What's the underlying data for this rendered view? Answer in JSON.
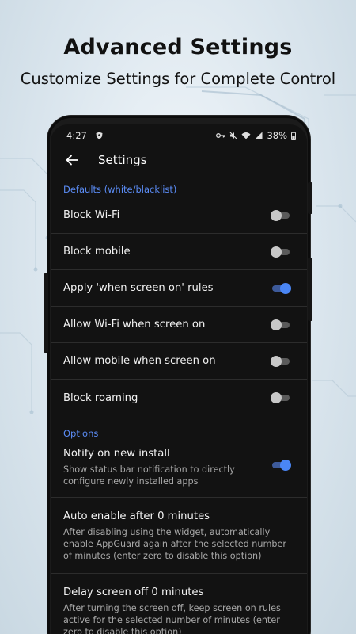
{
  "promo": {
    "title": "Advanced Settings",
    "subtitle": "Customize Settings for Complete Control"
  },
  "status_bar": {
    "time": "4:27",
    "battery": "38%",
    "icons": [
      "shield-icon",
      "key-icon",
      "mute-icon",
      "wifi-icon",
      "signal-icon",
      "battery-icon"
    ]
  },
  "toolbar": {
    "back_icon": "arrow-back-icon",
    "title": "Settings"
  },
  "defaults": {
    "header": "Defaults (white/blacklist)",
    "items": [
      {
        "label": "Block Wi-Fi",
        "on": false
      },
      {
        "label": "Block mobile",
        "on": false
      },
      {
        "label": "Apply 'when screen on' rules",
        "on": true
      },
      {
        "label": "Allow Wi-Fi when screen on",
        "on": false
      },
      {
        "label": "Allow mobile when screen on",
        "on": false
      },
      {
        "label": "Block roaming",
        "on": false
      }
    ]
  },
  "options": {
    "header": "Options",
    "items": [
      {
        "title": "Notify on new install",
        "description": "Show status bar notification to directly configure newly installed apps",
        "on": true
      },
      {
        "title": "Auto enable after 0 minutes",
        "description": "After disabling using the widget, automatically enable AppGuard again after the selected number of minutes (enter zero to disable this option)"
      },
      {
        "title": "Delay screen off 0 minutes",
        "description": "After turning the screen off, keep screen on rules active for the selected number of minutes (enter zero to disable this option)"
      }
    ]
  },
  "colors": {
    "accent": "#5b8cf5",
    "switch_on": "#4a86f5",
    "background": "#121212"
  }
}
